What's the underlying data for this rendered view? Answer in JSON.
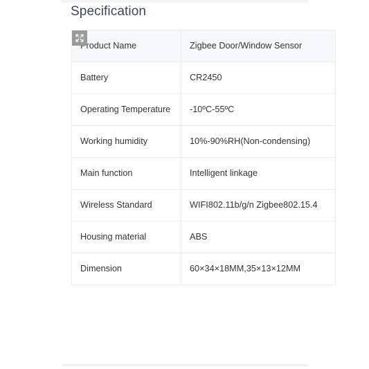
{
  "section": {
    "title": "Specification"
  },
  "icons": {
    "expand": "expand-arrows-icon"
  },
  "spec_table": {
    "rows": [
      {
        "label": "Product Name",
        "value": "Zigbee Door/Window Sensor"
      },
      {
        "label": "Battery",
        "value": "CR2450"
      },
      {
        "label": "Operating Temperature",
        "value": "-10ºC-55ºC"
      },
      {
        "label": "Working humidity",
        "value": "10%-90%RH(Non-condensing)"
      },
      {
        "label": "Main function",
        "value": "Intelligent linkage"
      },
      {
        "label": "Wireless Standard",
        "value": "WIFI802.11b/g/n Zigbee802.15.4"
      },
      {
        "label": "Housing material",
        "value": "ABS"
      },
      {
        "label": "Dimension",
        "value": "60×34×18MM,35×13×12MM"
      }
    ]
  },
  "colors": {
    "title": "#3f4656",
    "text": "#333333",
    "border": "#ededed",
    "first_row_bg": "#f7f8f9",
    "icon_bg": "#9a9a9a"
  }
}
